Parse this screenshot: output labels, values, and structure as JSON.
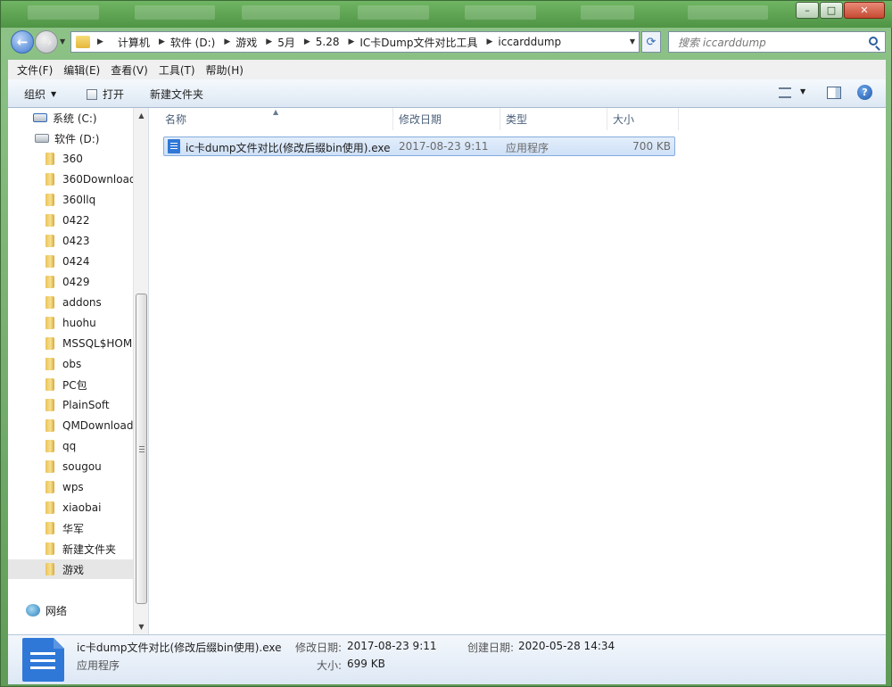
{
  "window": {
    "controls": {
      "minimize": "–",
      "maximize": "□",
      "close": "✕"
    }
  },
  "addressbar": {
    "crumbs": [
      "计算机",
      "软件 (D:)",
      "游戏",
      "5月",
      "5.28",
      "IC卡Dump文件对比工具",
      "iccarddump"
    ],
    "search_placeholder": "搜索 iccarddump"
  },
  "menubar": {
    "items": [
      "文件(F)",
      "编辑(E)",
      "查看(V)",
      "工具(T)",
      "帮助(H)"
    ]
  },
  "commandbar": {
    "organize": "组织",
    "open": "打开",
    "new_folder": "新建文件夹"
  },
  "navpane": {
    "drives": [
      "系统 (C:)",
      "软件 (D:)"
    ],
    "folders": [
      "360",
      "360Download",
      "360llq",
      "0422",
      "0423",
      "0424",
      "0429",
      "addons",
      "huohu",
      "MSSQL$HOM",
      "obs",
      "PC包",
      "PlainSoft",
      "QMDownload",
      "qq",
      "sougou",
      "wps",
      "xiaobai",
      "华军",
      "新建文件夹",
      "游戏"
    ],
    "selected": "游戏",
    "network": "网络"
  },
  "columns": {
    "name": "名称",
    "date": "修改日期",
    "type": "类型",
    "size": "大小"
  },
  "files": [
    {
      "name": "ic卡dump文件对比(修改后缀bin使用).exe",
      "date": "2017-08-23 9:11",
      "type": "应用程序",
      "size": "700 KB"
    }
  ],
  "details": {
    "filename": "ic卡dump文件对比(修改后缀bin使用).exe",
    "filetype": "应用程序",
    "modified_label": "修改日期:",
    "modified_value": "2017-08-23 9:11",
    "created_label": "创建日期:",
    "created_value": "2020-05-28 14:34",
    "size_label": "大小:",
    "size_value": "699 KB"
  }
}
